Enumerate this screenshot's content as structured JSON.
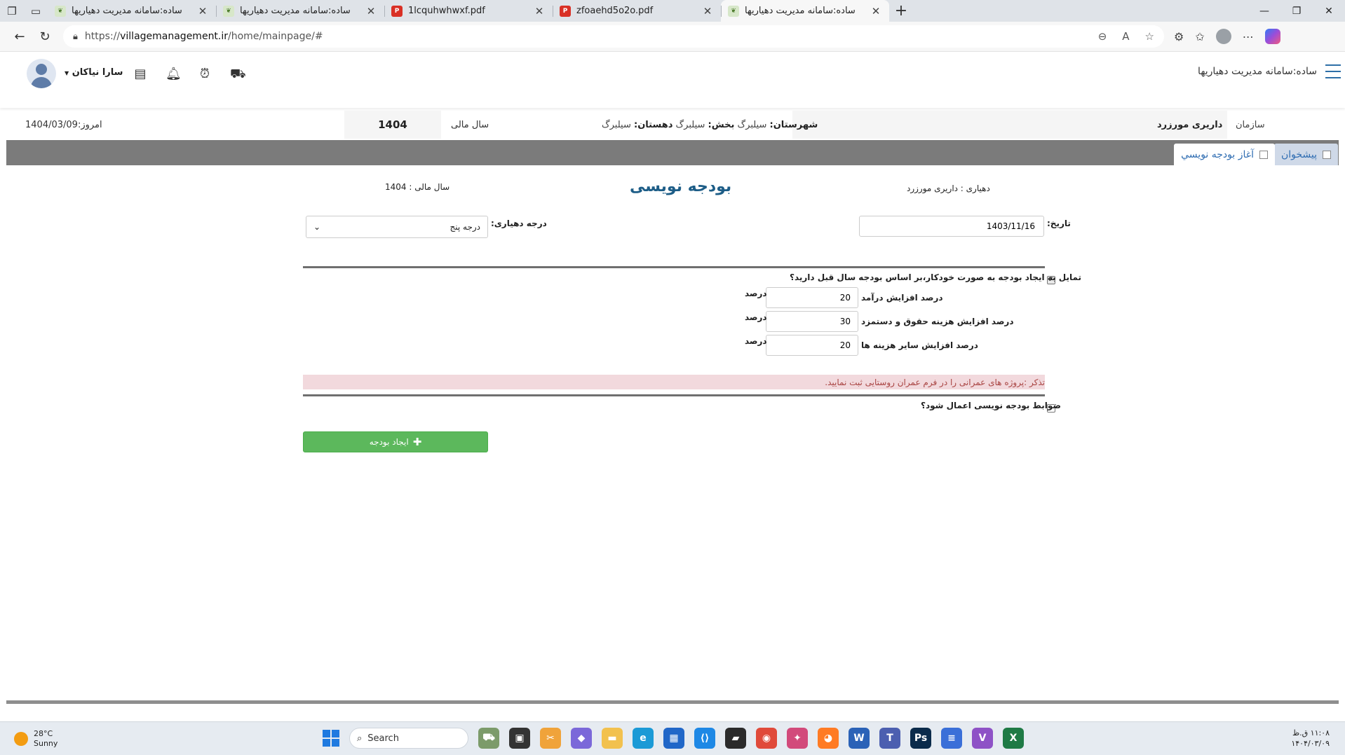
{
  "browser": {
    "tabs": [
      {
        "label": "ساده:سامانه مدیریت دهیاریها",
        "icon": "leaf",
        "active": false
      },
      {
        "label": "ساده:سامانه مدیریت دهیاریها",
        "icon": "leaf",
        "active": false
      },
      {
        "label": "1lcquhwhwxf.pdf",
        "icon": "pdf",
        "active": false
      },
      {
        "label": "zfoaehd5o2o.pdf",
        "icon": "pdf",
        "active": false
      },
      {
        "label": "ساده:سامانه مدیریت دهیاریها",
        "icon": "leaf",
        "active": true
      }
    ],
    "url_prefix": "https://",
    "url_host": "villagemanagement.ir",
    "url_path": "/home/mainpage/#"
  },
  "header": {
    "app_title": "ساده:سامانه مدیریت دهیاریها",
    "user_name": "سارا نیاکان"
  },
  "info": {
    "today": "امروز:1404/03/09",
    "fiscal_year_value": "1404",
    "fiscal_year_label": "سال مالی",
    "county_label": "شهرستان:",
    "county_value": "سیلبرگ",
    "district_label": "بخش:",
    "district_value": "سیلبرگ",
    "rural_label": "دهستان:",
    "rural_value": "سیلبرگ",
    "org_label": "سازمان",
    "org_value": "داریری مورزرد"
  },
  "tabs": {
    "dashboard": "پیشخوان",
    "budget_start": "آغاز بودجه نویسي"
  },
  "form": {
    "village": "دهیاری : داریری مورزرد",
    "title": "بودجه نویسی",
    "fiscal_year": "سال مالی : 1404",
    "date_label": "تاریخ:",
    "date_value": "1403/11/16",
    "grade_label": "درجه دهیاری:",
    "grade_value": "درجه پنج",
    "auto_question": "تمایل به ایجاد بودجه به صورت خودکار،بر اساس بودجه سال قبل دارید؟",
    "auto_checked": true,
    "rows": [
      {
        "label": "درصد افزایش درآمد",
        "value": "20",
        "unit": "درصد"
      },
      {
        "label": "درصد افزایش هزینه حقوق و دستمزد",
        "value": "30",
        "unit": "درصد"
      },
      {
        "label": "درصد افزایش سایر هزینه ها",
        "value": "20",
        "unit": "درصد"
      }
    ],
    "notice": "تذکر :پروژه های عمرانی را در فرم عمران روستایی ثبت نمایید.",
    "rules_question": "ضوابط بودجه نویسی اعمال شود؟",
    "rules_checked": false,
    "create_button": "ایجاد بودجه"
  },
  "taskbar": {
    "temp": "28°C",
    "condition": "Sunny",
    "search": "Search",
    "time": "۱۱:۰۸ ق.ظ",
    "date": "۱۴۰۴/۰۳/۰۹"
  }
}
